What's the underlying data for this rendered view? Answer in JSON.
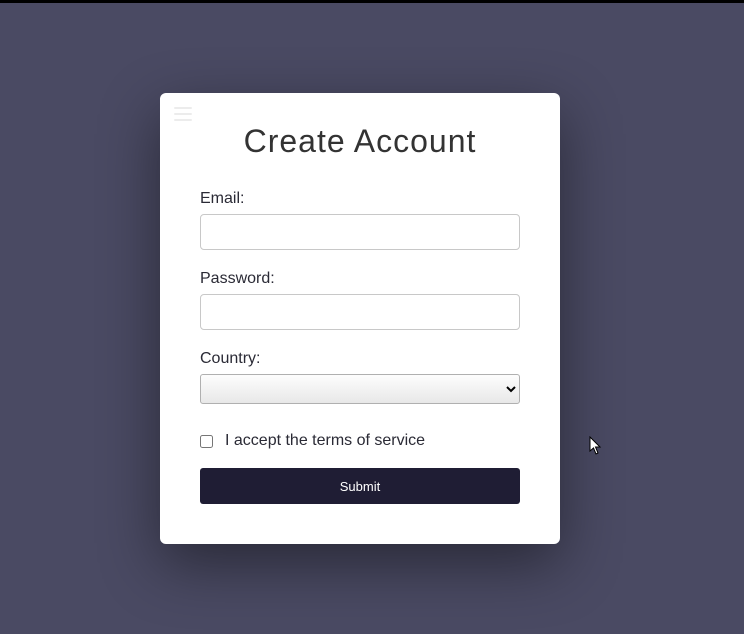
{
  "form": {
    "title": "Create Account",
    "email": {
      "label": "Email:",
      "value": ""
    },
    "password": {
      "label": "Password:",
      "value": ""
    },
    "country": {
      "label": "Country:",
      "selected": ""
    },
    "terms": {
      "label": "I accept the terms of service",
      "checked": false
    },
    "submit_label": "Submit"
  }
}
